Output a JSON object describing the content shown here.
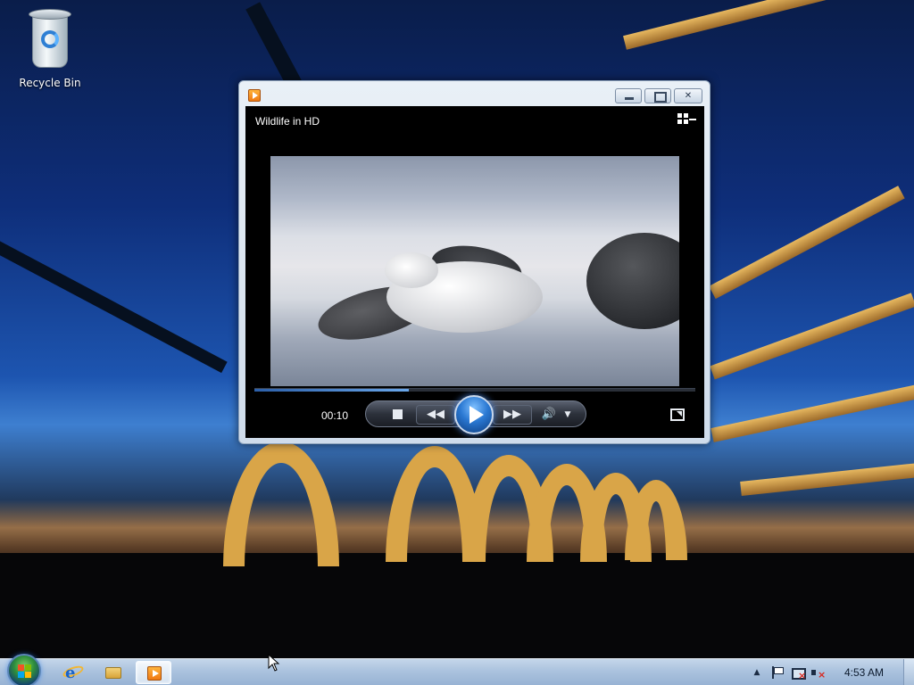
{
  "desktop": {
    "icons": [
      {
        "label": "Recycle Bin",
        "icon": "recycle-bin-icon"
      }
    ]
  },
  "player_window": {
    "app_icon": "media-player-icon",
    "title": "Wildlife in HD",
    "window_buttons": {
      "minimize": "minimize-icon",
      "maximize": "maximize-icon",
      "close": "✕"
    },
    "playback": {
      "elapsed": "00:10",
      "progress_fraction": 0.35
    },
    "controls": {
      "stop": "stop-icon",
      "rewind": "◀◀",
      "play": "play-icon",
      "fast_forward": "▶▶",
      "volume": "🔊",
      "volume_menu": "▼",
      "fullscreen": "fullscreen-icon",
      "switch_to_library": "switch-to-library-icon"
    }
  },
  "taskbar": {
    "start": "windows-logo-icon",
    "pinned": [
      {
        "name": "Internet Explorer",
        "icon": "internet-explorer-icon"
      },
      {
        "name": "Windows Explorer",
        "icon": "folder-icon"
      },
      {
        "name": "Windows Media Player",
        "icon": "media-player-icon",
        "active": true
      }
    ],
    "tray": {
      "show_hidden": "▲",
      "icons": [
        "action-center-flag-icon",
        "network-disconnected-icon",
        "volume-muted-icon"
      ],
      "clock": "4:53 AM"
    }
  },
  "colors": {
    "taskbar": "#a9c1dd",
    "player_background": "#000000",
    "seek_fill": "#4a86d4",
    "play_button": "#2a78d2"
  }
}
